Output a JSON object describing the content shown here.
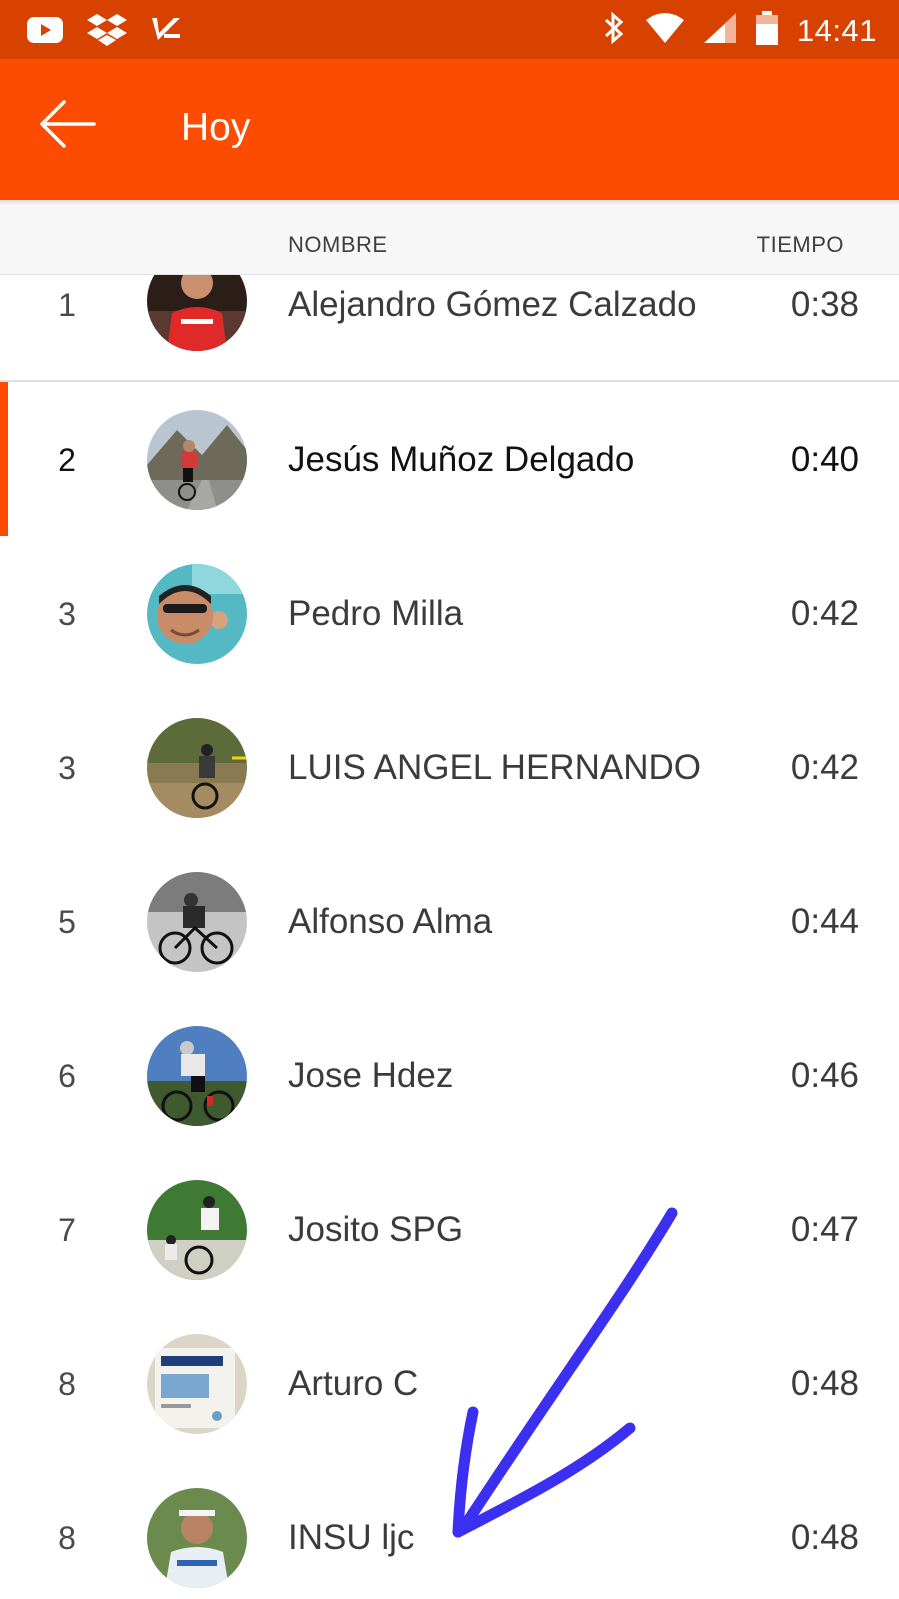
{
  "status_bar": {
    "time": "14:41",
    "icons": [
      "youtube-icon",
      "dropbox-icon",
      "check-app-icon",
      "bluetooth-icon",
      "wifi-icon",
      "signal-icon",
      "battery-icon"
    ]
  },
  "app_bar": {
    "title": "Hoy",
    "back_icon": "arrow-back-icon"
  },
  "table": {
    "header_name": "NOMBRE",
    "header_time": "TIEMPO",
    "rows": [
      {
        "rank": "1",
        "name": "Alejandro Gómez Calzado",
        "time": "0:38"
      },
      {
        "rank": "2",
        "name": "Jesús Muñoz Delgado",
        "time": "0:40",
        "selected": true
      },
      {
        "rank": "3",
        "name": "Pedro Milla",
        "time": "0:42"
      },
      {
        "rank": "3",
        "name": "LUIS ANGEL HERNANDO",
        "time": "0:42"
      },
      {
        "rank": "5",
        "name": "Alfonso Alma",
        "time": "0:44"
      },
      {
        "rank": "6",
        "name": "Jose Hdez",
        "time": "0:46"
      },
      {
        "rank": "7",
        "name": "Josito SPG",
        "time": "0:47"
      },
      {
        "rank": "8",
        "name": "Arturo C",
        "time": "0:48"
      },
      {
        "rank": "8",
        "name": "INSU ljc",
        "time": "0:48"
      }
    ]
  },
  "colors": {
    "status_bar": "#d84200",
    "app_bar": "#fc4c02",
    "highlight": "#fc4c02",
    "annotation_arrow": "#3b2ff0"
  }
}
